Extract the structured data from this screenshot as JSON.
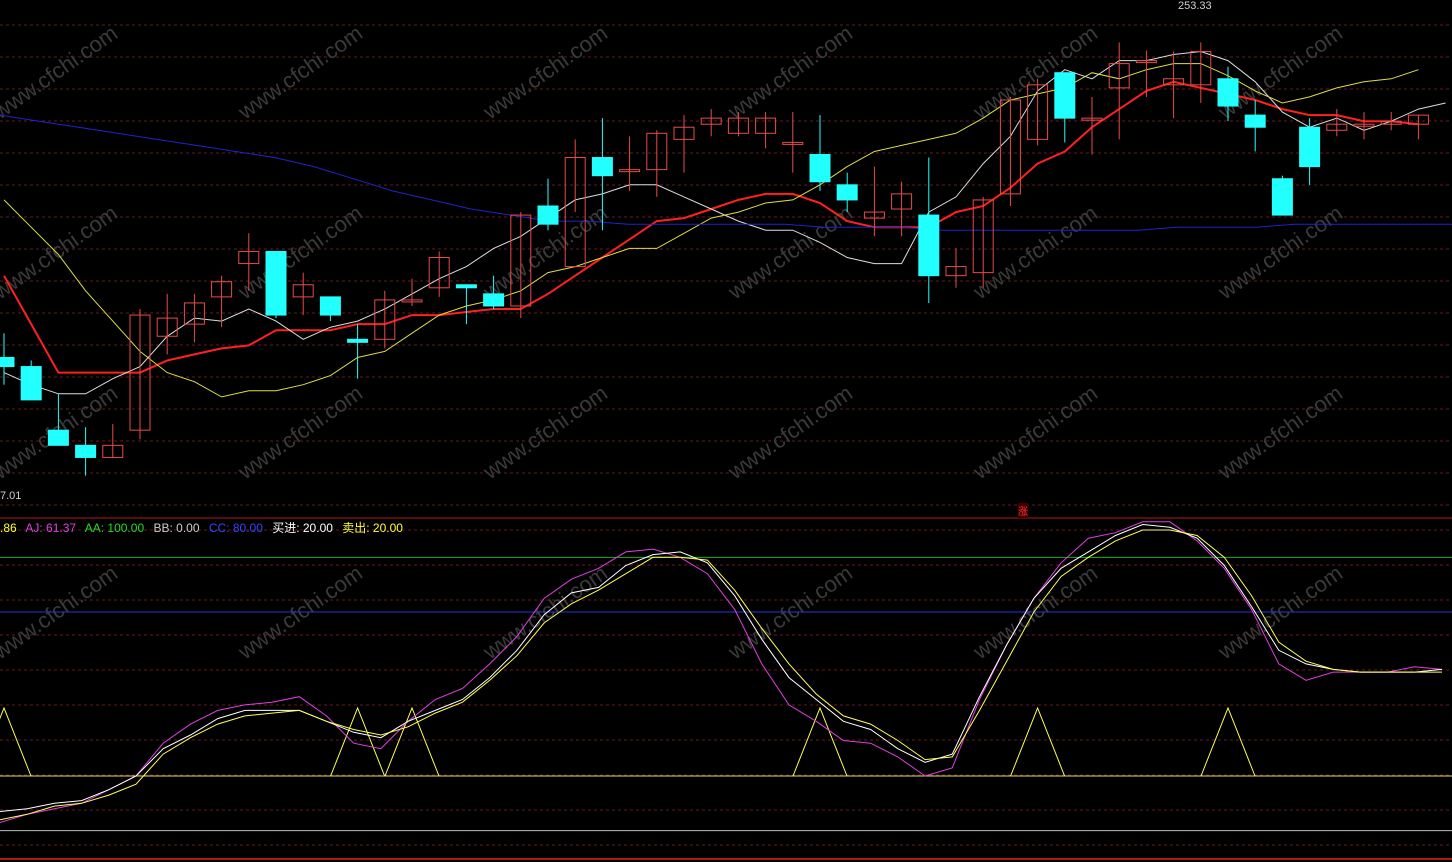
{
  "labels": {
    "high_price": "253.33",
    "low_price": "7.01",
    "zhang_marker": "涨"
  },
  "legend": [
    {
      "key": "j",
      "text": ".86",
      "color": "#ffff33"
    },
    {
      "key": "aj",
      "text": "AJ: 61.37",
      "color": "#e040e0"
    },
    {
      "key": "aa",
      "text": "AA: 100.00",
      "color": "#22dd22"
    },
    {
      "key": "bb",
      "text": "BB: 0.00",
      "color": "#cccccc"
    },
    {
      "key": "cc",
      "text": "CC: 80.00",
      "color": "#3344ff"
    },
    {
      "key": "buy",
      "text": "买进: 20.00",
      "color": "#ffffff"
    },
    {
      "key": "sell",
      "text": "卖出: 20.00",
      "color": "#ffff33"
    }
  ],
  "watermark": "www.cfchi.com",
  "colors": {
    "up": "#e84b4b",
    "down": "#22ffff",
    "ma_red": "#ff2020",
    "ma_white": "#dddddd",
    "ma_yellow": "#dddd44",
    "ma_blue": "#2222cc",
    "grid": "#6a1a1a",
    "divider": "#b01818"
  },
  "chart_data": [
    {
      "type": "candlestick",
      "indicator": "price",
      "ylim": [
        100,
        270
      ],
      "high_label": "253.33",
      "candles": [
        {
          "o": 152,
          "h": 160,
          "l": 143,
          "c": 149
        },
        {
          "o": 149,
          "h": 151,
          "l": 139,
          "c": 138
        },
        {
          "o": 128,
          "h": 140,
          "l": 128,
          "c": 123
        },
        {
          "o": 123,
          "h": 129,
          "l": 113,
          "c": 119
        },
        {
          "o": 119,
          "h": 130,
          "l": 119,
          "c": 123
        },
        {
          "o": 128,
          "h": 168,
          "l": 125,
          "c": 166
        },
        {
          "o": 159,
          "h": 173,
          "l": 153,
          "c": 165
        },
        {
          "o": 163,
          "h": 173,
          "l": 157,
          "c": 170
        },
        {
          "o": 172,
          "h": 179,
          "l": 162,
          "c": 177
        },
        {
          "o": 183,
          "h": 193,
          "l": 174,
          "c": 187
        },
        {
          "o": 187,
          "h": 187,
          "l": 165,
          "c": 166
        },
        {
          "o": 172,
          "h": 180,
          "l": 166,
          "c": 176
        },
        {
          "o": 172,
          "h": 172,
          "l": 164,
          "c": 166
        },
        {
          "o": 158,
          "h": 163,
          "l": 145,
          "c": 157
        },
        {
          "o": 158,
          "h": 174,
          "l": 155,
          "c": 171
        },
        {
          "o": 171,
          "h": 178,
          "l": 169,
          "c": 171
        },
        {
          "o": 175,
          "h": 187,
          "l": 172,
          "c": 185
        },
        {
          "o": 176,
          "h": 176,
          "l": 163,
          "c": 175
        },
        {
          "o": 173,
          "h": 179,
          "l": 168,
          "c": 169
        },
        {
          "o": 169,
          "h": 200,
          "l": 165,
          "c": 199
        },
        {
          "o": 202,
          "h": 211,
          "l": 194,
          "c": 196
        },
        {
          "o": 182,
          "h": 224,
          "l": 200,
          "c": 218
        },
        {
          "o": 218,
          "h": 231,
          "l": 194,
          "c": 212
        },
        {
          "o": 214,
          "h": 225,
          "l": 207,
          "c": 214
        },
        {
          "o": 214,
          "h": 227,
          "l": 205,
          "c": 226
        },
        {
          "o": 224,
          "h": 232,
          "l": 213,
          "c": 228
        },
        {
          "o": 229,
          "h": 234,
          "l": 225,
          "c": 231
        },
        {
          "o": 226,
          "h": 233,
          "l": 225,
          "c": 231
        },
        {
          "o": 226,
          "h": 233,
          "l": 221,
          "c": 231
        },
        {
          "o": 223,
          "h": 233,
          "l": 213,
          "c": 223
        },
        {
          "o": 219,
          "h": 232,
          "l": 207,
          "c": 210
        },
        {
          "o": 209,
          "h": 213,
          "l": 200,
          "c": 204
        },
        {
          "o": 198,
          "h": 215,
          "l": 192,
          "c": 200
        },
        {
          "o": 201,
          "h": 210,
          "l": 192,
          "c": 206
        },
        {
          "o": 199,
          "h": 218,
          "l": 170,
          "c": 179
        },
        {
          "o": 179,
          "h": 188,
          "l": 175,
          "c": 182
        },
        {
          "o": 180,
          "h": 205,
          "l": 175,
          "c": 204
        },
        {
          "o": 206,
          "h": 238,
          "l": 202,
          "c": 237
        },
        {
          "o": 224,
          "h": 244,
          "l": 222,
          "c": 242
        },
        {
          "o": 246,
          "h": 246,
          "l": 223,
          "c": 231
        },
        {
          "o": 231,
          "h": 238,
          "l": 219,
          "c": 231
        },
        {
          "o": 241,
          "h": 256,
          "l": 224,
          "c": 249
        },
        {
          "o": 250,
          "h": 253.33,
          "l": 238,
          "c": 250
        },
        {
          "o": 242,
          "h": 253,
          "l": 231,
          "c": 244
        },
        {
          "o": 242,
          "h": 256,
          "l": 236,
          "c": 253
        },
        {
          "o": 244,
          "h": 248,
          "l": 230,
          "c": 235
        },
        {
          "o": 232,
          "h": 237,
          "l": 220,
          "c": 228
        },
        {
          "o": 211,
          "h": 212,
          "l": 200,
          "c": 199
        },
        {
          "o": 228,
          "h": 231,
          "l": 209,
          "c": 215
        },
        {
          "o": 227,
          "h": 234,
          "l": 225,
          "c": 229
        },
        {
          "o": 229,
          "h": 233,
          "l": 224,
          "c": 229
        },
        {
          "o": 229,
          "h": 233,
          "l": 227,
          "c": 230
        },
        {
          "o": 229,
          "h": 232,
          "l": 224,
          "c": 232
        }
      ],
      "series": [
        {
          "color_key": "ma_red",
          "values": [
            179,
            163,
            147,
            147,
            147,
            147,
            151,
            153,
            155,
            156,
            161,
            161,
            161,
            163,
            163,
            166,
            166,
            167,
            168,
            168,
            173,
            179,
            185,
            191,
            197,
            198,
            201,
            204,
            206,
            206,
            203,
            197,
            195,
            195,
            195,
            200,
            202,
            208,
            216,
            220,
            228,
            234,
            240,
            243,
            241,
            239,
            237,
            234,
            232,
            232,
            230,
            230,
            229
          ]
        },
        {
          "color_key": "ma_white",
          "values": [
            147,
            143,
            140,
            140,
            145,
            149,
            159,
            165,
            164,
            168,
            164,
            158,
            162,
            164,
            168,
            173,
            178,
            182,
            188,
            192,
            198,
            204,
            206,
            209,
            209,
            205,
            201,
            197,
            194,
            194,
            190,
            185,
            183,
            183,
            200,
            205,
            216,
            225,
            240,
            247,
            244,
            250,
            250,
            252,
            253,
            250,
            243,
            233,
            228,
            231,
            227,
            230,
            234,
            236
          ]
        },
        {
          "color_key": "ma_yellow",
          "values": [
            204,
            195,
            186,
            174,
            164,
            154,
            147,
            144,
            139,
            141,
            141,
            143,
            146,
            152,
            154,
            160,
            166,
            169,
            171,
            174,
            180,
            182,
            185,
            188,
            188,
            193,
            198,
            200,
            203,
            204,
            209,
            215,
            220,
            222,
            224,
            226,
            231,
            237,
            239,
            241,
            246,
            244,
            247,
            249,
            249,
            245,
            240,
            236,
            238,
            241,
            243,
            244,
            247
          ]
        },
        {
          "color_key": "ma_blue",
          "values": [
            232,
            230,
            228,
            226,
            224,
            222,
            220,
            218,
            215,
            211,
            207,
            204,
            201,
            199,
            197,
            197,
            196,
            196,
            196,
            196,
            196,
            195,
            195,
            195,
            194,
            194,
            194,
            194,
            194,
            194,
            195,
            195,
            195,
            196,
            196,
            196,
            196,
            196
          ]
        }
      ]
    },
    {
      "type": "line",
      "indicator": "KDJ",
      "ylim": [
        -10,
        110
      ],
      "levels": {
        "AA": 100,
        "BB": 0,
        "CC": 80,
        "buy": 20,
        "sell": 20
      },
      "series": [
        {
          "name": "AJ",
          "color_key": "aj",
          "values": [
            3,
            6,
            8,
            10,
            15,
            20,
            32,
            39,
            44,
            46,
            47,
            49,
            42,
            32,
            30,
            40,
            48,
            52,
            61,
            71,
            85,
            92,
            96,
            102,
            103,
            100,
            94,
            81,
            61,
            46,
            40,
            33,
            32,
            27,
            20,
            23,
            48,
            68,
            85,
            98,
            107,
            109,
            113,
            113,
            106,
            96,
            81,
            61,
            55,
            58,
            58,
            58,
            60,
            59
          ]
        },
        {
          "name": "K",
          "color_key": "ma_white",
          "values": [
            7,
            8,
            10,
            11,
            15,
            20,
            30,
            35,
            41,
            44,
            44,
            44,
            40,
            36,
            34,
            40,
            44,
            48,
            56,
            66,
            79,
            87,
            89,
            97,
            101,
            102,
            98,
            86,
            70,
            56,
            48,
            40,
            37,
            30,
            25,
            28,
            49,
            68,
            85,
            96,
            102,
            108,
            112,
            111,
            107,
            97,
            82,
            66,
            61,
            59,
            58,
            58,
            58,
            59
          ]
        },
        {
          "name": "D",
          "color_key": "ma_yellow",
          "values": [
            4,
            6,
            9,
            10,
            13,
            17,
            28,
            34,
            39,
            42,
            43,
            44,
            40,
            37,
            35,
            38,
            43,
            47,
            55,
            64,
            76,
            83,
            88,
            94,
            100,
            100,
            99,
            88,
            74,
            61,
            50,
            42,
            39,
            33,
            26,
            27,
            44,
            62,
            80,
            93,
            100,
            106,
            110,
            110,
            108,
            100,
            86,
            69,
            62,
            59,
            58,
            58,
            58,
            58
          ]
        },
        {
          "name": "signal",
          "color_key": "j",
          "values": [
            20,
            20,
            20,
            20,
            20,
            20,
            20,
            20,
            20,
            20,
            20,
            20,
            20,
            20,
            20,
            20,
            20,
            20,
            20,
            20,
            20,
            20,
            20,
            20,
            20,
            20,
            20,
            20,
            20,
            20,
            20,
            20,
            20,
            20,
            20,
            20,
            20,
            20,
            20,
            20,
            20,
            20,
            20,
            20,
            20,
            20,
            20,
            20,
            20,
            20,
            20,
            20,
            20,
            20
          ]
        }
      ]
    }
  ]
}
